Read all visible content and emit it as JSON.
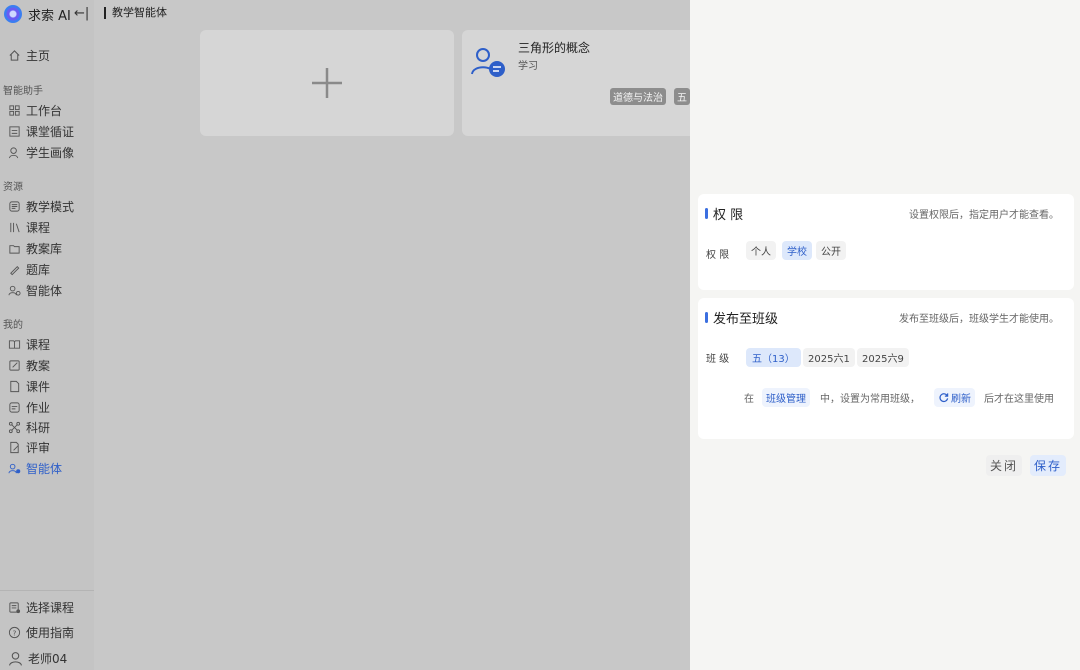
{
  "app": {
    "brand_name": "求索 AI",
    "collapse_glyph": "←|",
    "page_title": "教学智能体"
  },
  "sidebar": {
    "home": "主页",
    "groups": {
      "assistant": "智能助手",
      "resources": "资源",
      "mine": "我的"
    },
    "assistant_items": [
      "工作台",
      "课堂循证",
      "学生画像"
    ],
    "resource_items": [
      "教学模式",
      "课程",
      "教案库",
      "题库",
      "智能体"
    ],
    "mine_items": [
      "课程",
      "教案",
      "课件",
      "作业",
      "科研",
      "评审",
      "智能体"
    ],
    "bottom": {
      "select_course": "选择课程",
      "guide": "使用指南",
      "user": "老师04"
    }
  },
  "main": {
    "agent_card": {
      "title": "三角形的概念",
      "subtitle": "学习",
      "tags": [
        "道德与法治",
        "五"
      ]
    }
  },
  "drawer": {
    "permission": {
      "title": "权 限",
      "description": "设置权限后，指定用户才能查看。",
      "field_label": "权 限",
      "options": [
        "个人",
        "学校",
        "公开"
      ],
      "selected": "学校"
    },
    "publish": {
      "title": "发布至班级",
      "description": "发布至班级后，班级学生才能使用。",
      "field_label": "班 级",
      "classes": [
        "五（13）",
        "2025六1",
        "2025六9"
      ],
      "selected": "五（13）",
      "hint_prefix": "在",
      "hint_link": "班级管理",
      "hint_middle": "中，设置为常用班级，",
      "refresh_label": "刷新",
      "hint_suffix": "后才在这里使用"
    },
    "actions": {
      "close": "关闭",
      "save": "保存"
    }
  },
  "colors": {
    "accent": "#2e5fc9",
    "accent_bar": "#3b6fe0",
    "overlay_bg": "#c8c8c8",
    "drawer_bg": "#f5f5f3"
  }
}
